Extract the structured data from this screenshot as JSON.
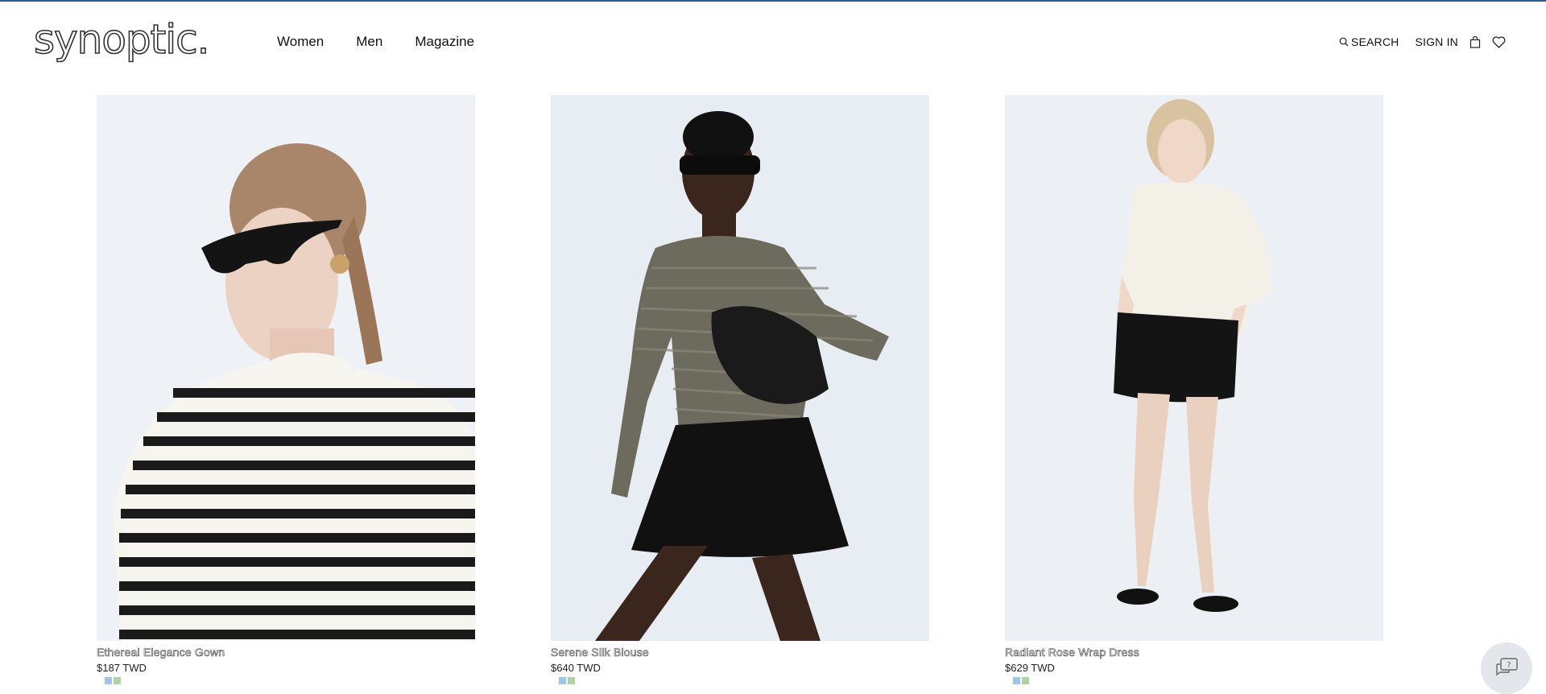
{
  "brand": {
    "logo_text": "synoptic."
  },
  "nav": {
    "items": [
      "Women",
      "Men",
      "Magazine"
    ]
  },
  "utility": {
    "search_label": "SEARCH",
    "signin_label": "SIGN IN"
  },
  "products": [
    {
      "name": "Ethereal Elegance Gown",
      "price": "$187 TWD",
      "swatches": [
        "#9ec6e8",
        "#a8d8a0"
      ]
    },
    {
      "name": "Serene Silk Blouse",
      "price": "$640 TWD",
      "swatches": [
        "#9ec6e8",
        "#a8d8a0"
      ]
    },
    {
      "name": "Radiant Rose Wrap Dress",
      "price": "$629 TWD",
      "swatches": [
        "#9ec6e8",
        "#a8d8a0"
      ]
    }
  ],
  "colors": {
    "accent_line": "#2f5a8a"
  }
}
